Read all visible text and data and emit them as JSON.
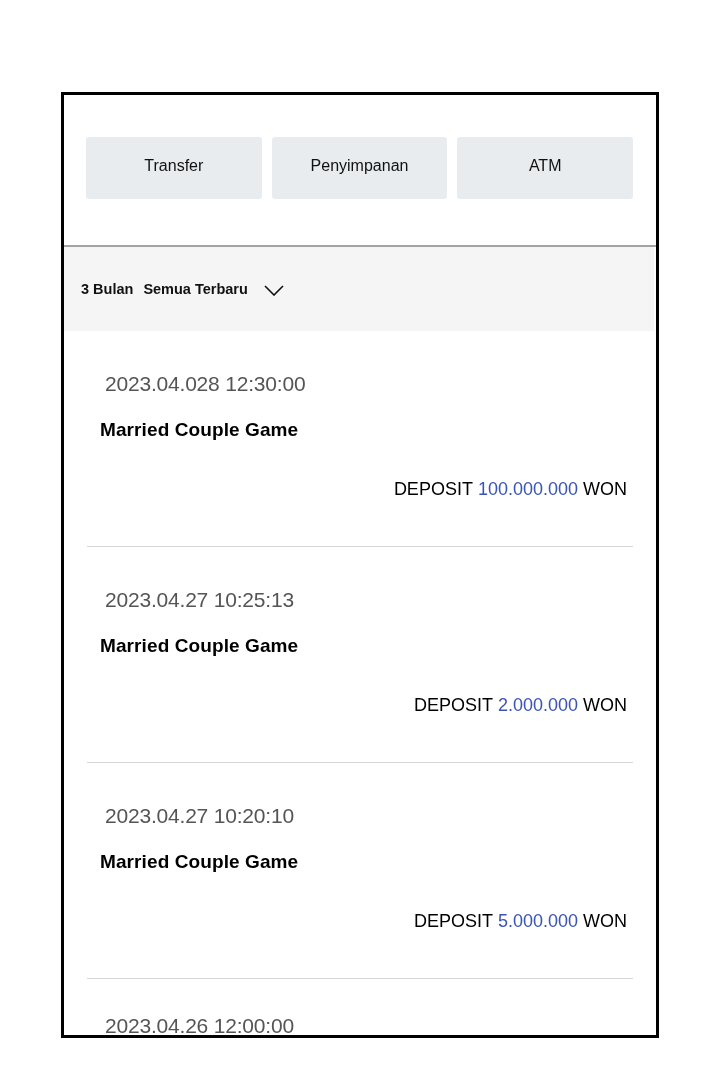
{
  "buttons": [
    {
      "label": "Transfer"
    },
    {
      "label": "Penyimpanan"
    },
    {
      "label": "ATM"
    }
  ],
  "filter": {
    "period": "3 Bulan",
    "sort": "Semua Terbaru"
  },
  "transactions": [
    {
      "datetime": "2023.04.028 12:30:00",
      "title": "Married Couple Game",
      "type_label": "DEPOSIT",
      "amount": "100.000.000",
      "currency": "WON"
    },
    {
      "datetime": "2023.04.27 10:25:13",
      "title": "Married Couple Game",
      "type_label": "DEPOSIT",
      "amount": "2.000.000",
      "currency": "WON"
    },
    {
      "datetime": "2023.04.27 10:20:10",
      "title": "Married Couple Game",
      "type_label": "DEPOSIT",
      "amount": "5.000.000",
      "currency": "WON"
    },
    {
      "datetime": "2023.04.26 12:00:00"
    }
  ]
}
